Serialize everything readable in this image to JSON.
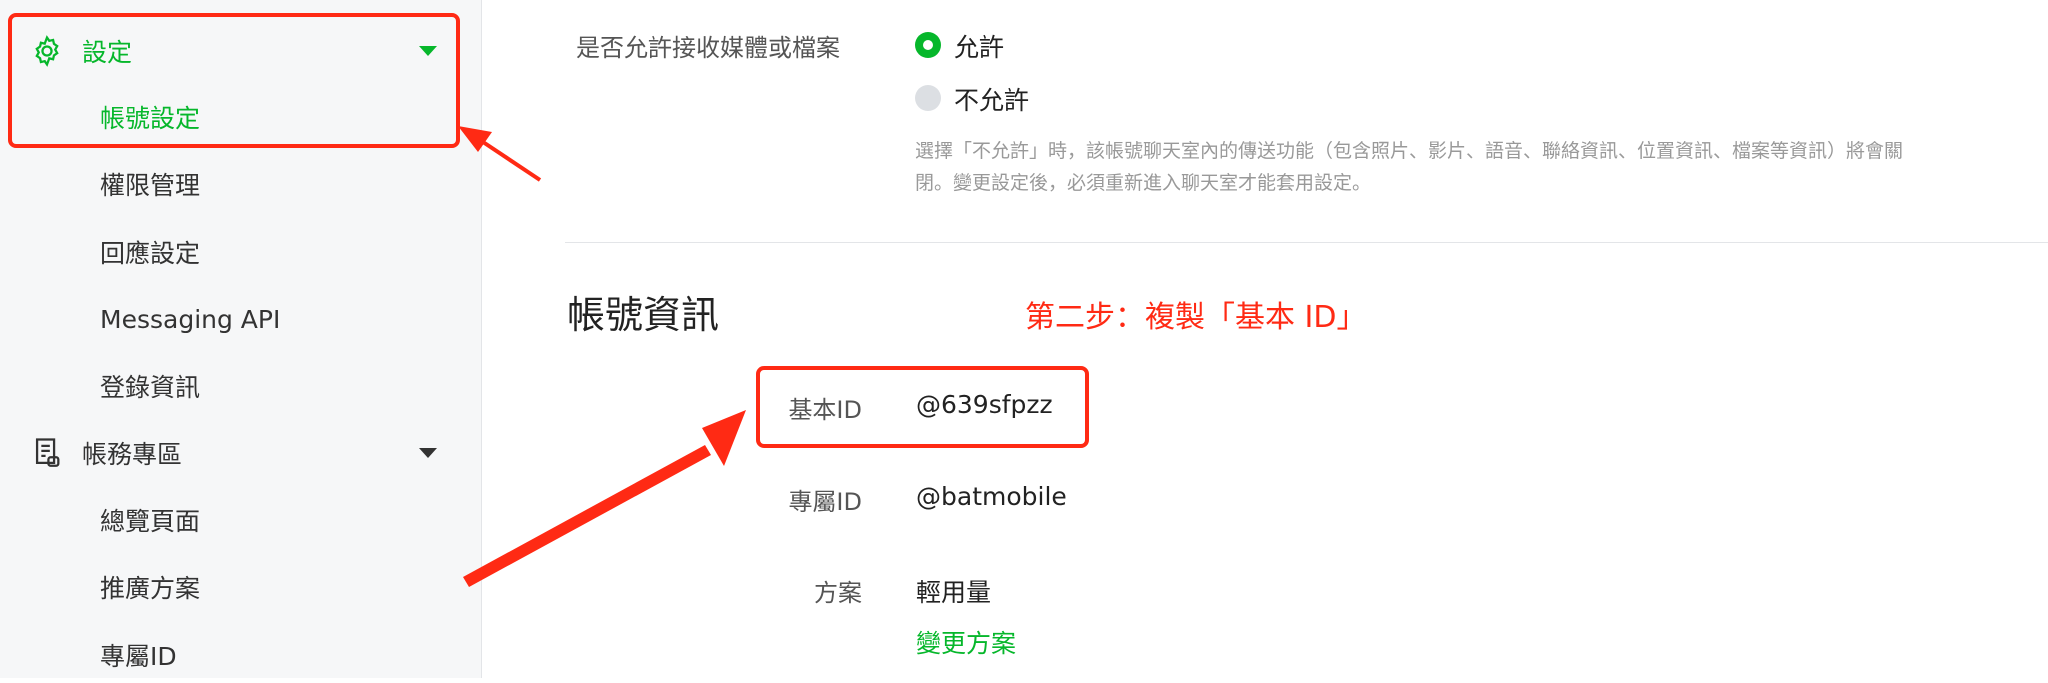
{
  "sidebar": {
    "settings": {
      "label": "設定"
    },
    "settings_items": [
      "帳號設定",
      "權限管理",
      "回應設定",
      "Messaging API",
      "登錄資訊"
    ],
    "billing": {
      "label": "帳務專區"
    },
    "billing_items": [
      "總覽頁面",
      "推廣方案",
      "專屬ID"
    ]
  },
  "media": {
    "question": "是否允許接收媒體或檔案",
    "option_allow": "允許",
    "option_disallow": "不允許",
    "hint": "選擇「不允許」時，該帳號聊天室內的傳送功能（包含照片、影片、語音、聯絡資訊、位置資訊、檔案等資訊）將會關閉。變更設定後，必須重新進入聊天室才能套用設定。",
    "selected": "允許"
  },
  "account_info": {
    "heading": "帳號資訊",
    "annotation": "第二步：複製「基本 ID」",
    "basic_id_label": "基本ID",
    "basic_id_value": "@639sfpzz",
    "premium_id_label": "專屬ID",
    "premium_id_value": "@batmobile",
    "plan_label": "方案",
    "plan_value": "輕用量",
    "change_plan": "變更方案"
  },
  "colors": {
    "accent_green": "#06b72b",
    "annotation_red": "#ff2a14"
  },
  "icons": {
    "settings": "gear-icon",
    "billing": "receipt-icon",
    "expand": "caret-down-icon"
  }
}
